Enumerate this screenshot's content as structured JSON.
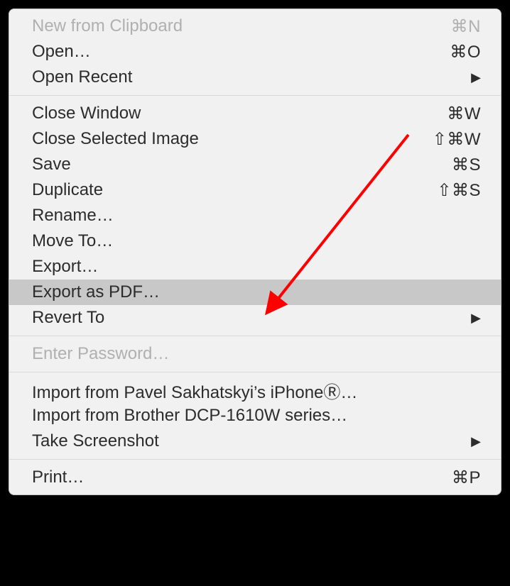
{
  "menu": {
    "sections": [
      {
        "items": [
          {
            "id": "new-from-clipboard",
            "label": "New from Clipboard",
            "shortcut": "⌘N",
            "disabled": true
          },
          {
            "id": "open",
            "label": "Open…",
            "shortcut": "⌘O"
          },
          {
            "id": "open-recent",
            "label": "Open Recent",
            "submenu": true
          }
        ]
      },
      {
        "items": [
          {
            "id": "close-window",
            "label": "Close Window",
            "shortcut": "⌘W"
          },
          {
            "id": "close-selected-image",
            "label": "Close Selected Image",
            "shortcut": "⇧⌘W"
          },
          {
            "id": "save",
            "label": "Save",
            "shortcut": "⌘S"
          },
          {
            "id": "duplicate",
            "label": "Duplicate",
            "shortcut": "⇧⌘S"
          },
          {
            "id": "rename",
            "label": "Rename…"
          },
          {
            "id": "move-to",
            "label": "Move To…"
          },
          {
            "id": "export",
            "label": "Export…"
          },
          {
            "id": "export-as-pdf",
            "label": "Export as PDF…",
            "highlighted": true
          },
          {
            "id": "revert-to",
            "label": "Revert To",
            "submenu": true
          }
        ]
      },
      {
        "items": [
          {
            "id": "enter-password",
            "label": "Enter Password…",
            "disabled": true
          }
        ]
      },
      {
        "items": [
          {
            "id": "import-from-iphone",
            "label": "Import from Pavel Sakhatskyi’s iPhoneⓇ…"
          },
          {
            "id": "import-from-brother",
            "label": "Import from Brother DCP-1610W series…"
          },
          {
            "id": "take-screenshot",
            "label": "Take Screenshot",
            "submenu": true
          }
        ]
      },
      {
        "items": [
          {
            "id": "print",
            "label": "Print…",
            "shortcut": "⌘P"
          }
        ]
      }
    ]
  },
  "annotation": {
    "arrow_color": "#ff0000"
  }
}
